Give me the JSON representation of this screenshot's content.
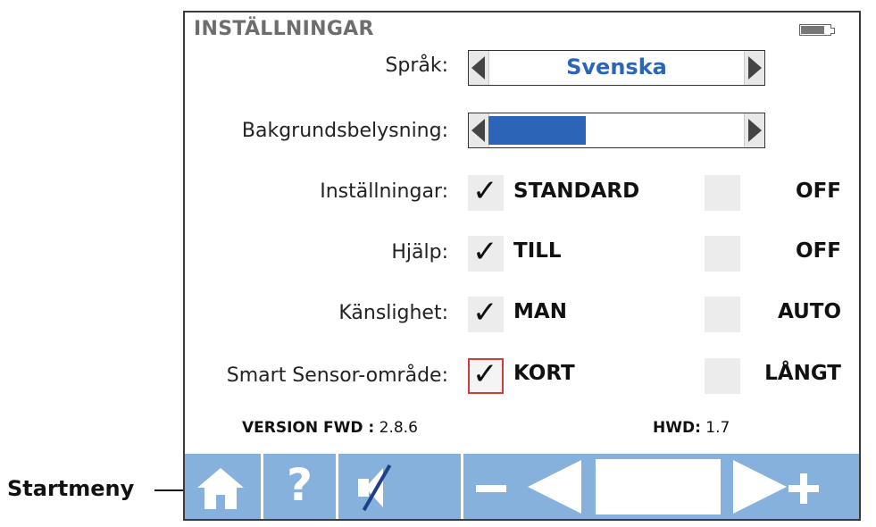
{
  "callout": {
    "label": "Startmeny"
  },
  "screen": {
    "title": "INSTÄLLNINGAR",
    "battery_icon": "battery-icon"
  },
  "settings": {
    "language": {
      "label": "Språk:",
      "value": "Svenska"
    },
    "backlight": {
      "label": "Bakgrundsbelysning:",
      "level_fraction": 0.38
    },
    "rows": [
      {
        "label": "Inställningar:",
        "option_left": "STANDARD",
        "option_right": "OFF",
        "checked": "left"
      },
      {
        "label": "Hjälp:",
        "option_left": "TILL",
        "option_right": "OFF",
        "checked": "left"
      },
      {
        "label": "Känslighet:",
        "option_left": "MAN",
        "option_right": "AUTO",
        "checked": "left"
      },
      {
        "label": "Smart Sensor-område:",
        "option_left": "KORT",
        "option_right": "LÅNGT",
        "checked": "left"
      }
    ],
    "check_glyph": "✓"
  },
  "version": {
    "fwd_label": "VERSION FWD :",
    "fwd_value": "2.8.6",
    "hwd_label": "HWD:",
    "hwd_value": "1.7"
  },
  "toolbar": {
    "help_glyph": "?",
    "icons": [
      "home-icon",
      "help-icon",
      "mute-icon",
      "minus-icon",
      "arrow-left-icon",
      "arrow-right-icon",
      "plus-icon"
    ]
  },
  "colors": {
    "accent_blue": "#2c64b8",
    "toolbar_blue": "#86b1dc",
    "title_gray": "#6d6d6d",
    "highlight_red": "#d33a3a"
  }
}
